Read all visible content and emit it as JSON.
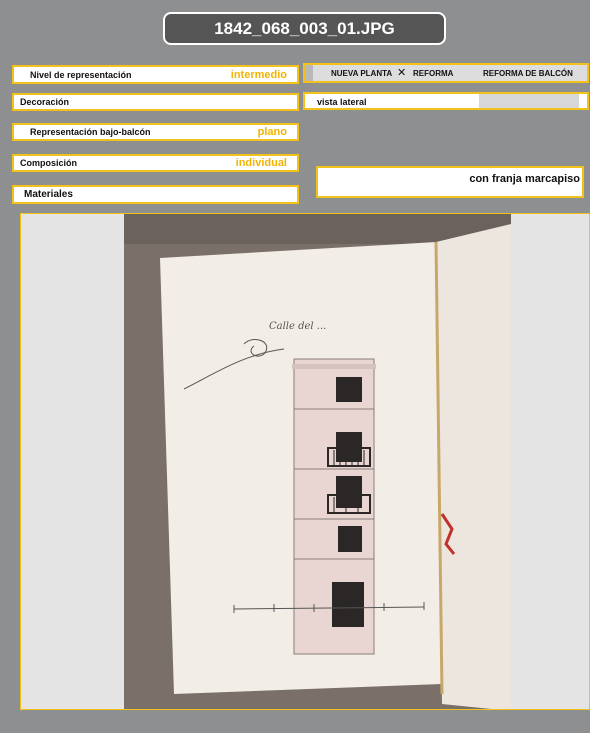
{
  "header": {
    "filename": "1842_068_003_01.JPG"
  },
  "fields": {
    "nivel": {
      "label": "Nivel de representación",
      "value": "intermedio"
    },
    "decoracion": {
      "label": "Decoración",
      "value": ""
    },
    "bajo_balcon": {
      "label": "Representación bajo-balcón",
      "value": "plano"
    },
    "composicion": {
      "label": "Composición",
      "value": "individual"
    },
    "materiales": {
      "label": "Materiales",
      "value": ""
    }
  },
  "options": {
    "nueva_planta": "NUEVA PLANTA",
    "mark": "✕",
    "reforma": "REFORMA",
    "reforma_balcon": "REFORMA DE BALCÓN",
    "vista": "vista lateral",
    "marcapiso": "con franja marcapiso"
  },
  "colors": {
    "accent": "#f2c21b",
    "background": "#8e8f91",
    "title_bg": "#555556"
  }
}
